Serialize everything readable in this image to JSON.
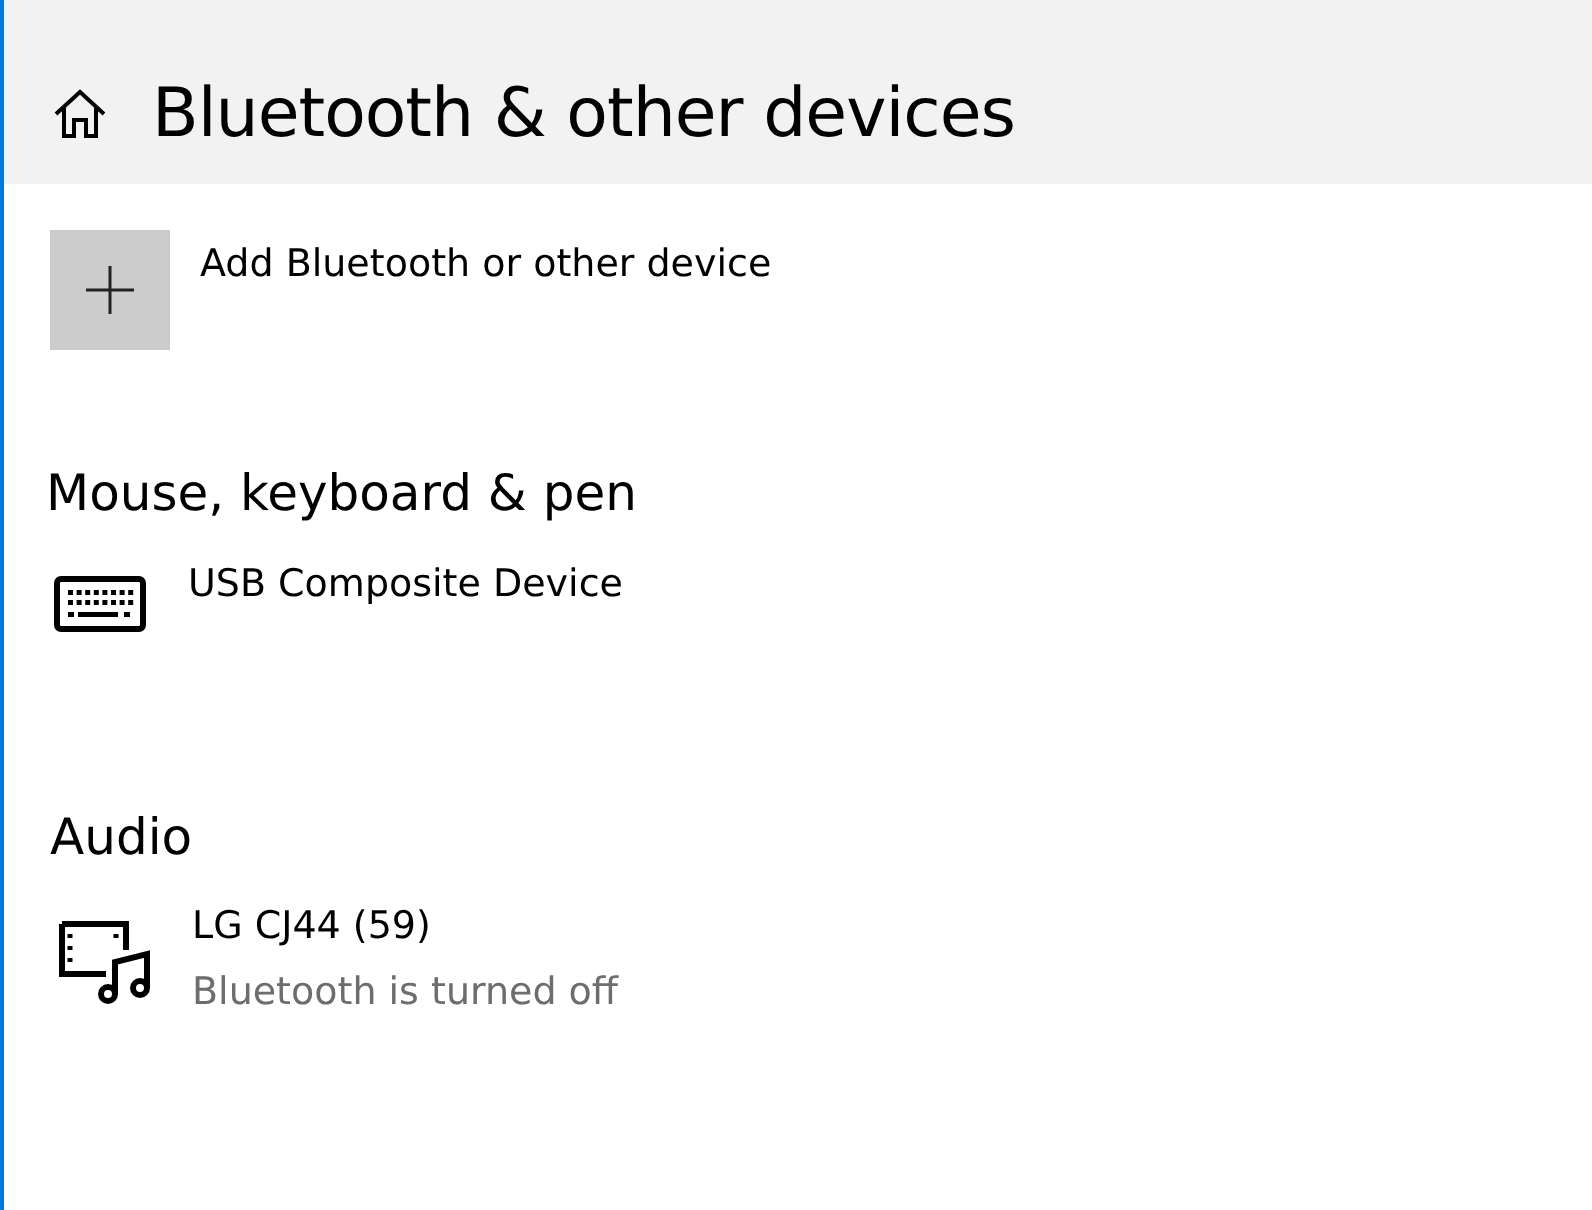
{
  "header": {
    "title": "Bluetooth & other devices"
  },
  "add_device": {
    "label": "Add Bluetooth or other device"
  },
  "sections": [
    {
      "heading": "Mouse, keyboard & pen",
      "devices": [
        {
          "kind": "keyboard",
          "name": "USB Composite Device"
        }
      ]
    },
    {
      "heading": "Audio",
      "devices": [
        {
          "kind": "audio",
          "name": "LG CJ44  (59)",
          "status": "Bluetooth is turned off"
        }
      ]
    }
  ]
}
